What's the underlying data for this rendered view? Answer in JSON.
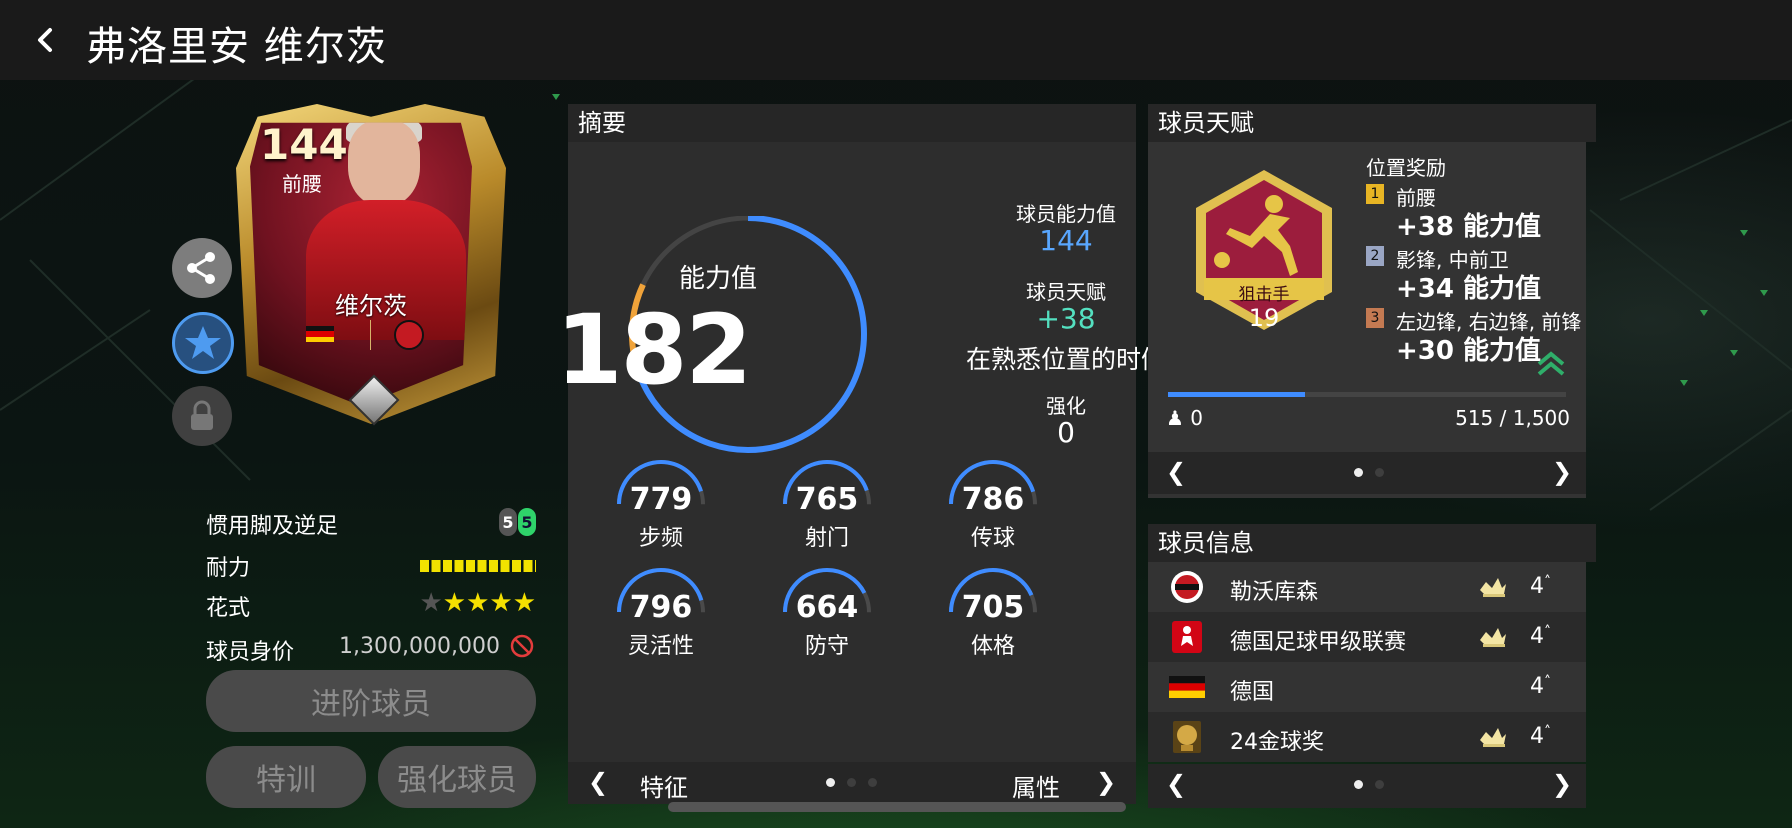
{
  "header": {
    "title": "弗洛里安 维尔茨"
  },
  "card": {
    "rating": "144",
    "position": "前腰",
    "name": "维尔茨",
    "nation_flag": "germany-flag",
    "club_badge": "leverkusen-badge"
  },
  "left_stats": {
    "foot_label": "惯用脚及逆足",
    "foot_values": [
      "5",
      "5"
    ],
    "stamina_label": "耐力",
    "skill_label": "花式",
    "skill_stars": 4,
    "skill_stars_max": 5,
    "price_label": "球员身价",
    "price_value": "1,300,000,000"
  },
  "buttons": {
    "upgrade": "进阶球员",
    "train": "特训",
    "enhance": "强化球员"
  },
  "summary": {
    "header": "摘要",
    "ring_label": "能力值",
    "ring_value": "182",
    "ring_fraction_blue": 0.72,
    "ring_fraction_orange": 0.1,
    "ability_label": "球员能力值",
    "ability_value": "144",
    "talent_label": "球员天赋",
    "talent_value": "+38",
    "talent_note": "在熟悉位置的时候",
    "enhance_label": "强化",
    "enhance_value": "0",
    "attributes": [
      {
        "name": "步频",
        "value": "779"
      },
      {
        "name": "射门",
        "value": "765"
      },
      {
        "name": "传球",
        "value": "786"
      },
      {
        "name": "灵活性",
        "value": "796"
      },
      {
        "name": "防守",
        "value": "664"
      },
      {
        "name": "体格",
        "value": "705"
      }
    ],
    "pager_left": "特征",
    "pager_right": "属性"
  },
  "talent": {
    "header": "球员天赋",
    "badge_name": "狙击手",
    "badge_level": "19",
    "bonus_title": "位置奖励",
    "bonuses": [
      {
        "rank": "1",
        "positions": "前腰",
        "amount": "+38 能力值",
        "color": "#e8b524"
      },
      {
        "rank": "2",
        "positions": "影锋, 中前卫",
        "amount": "+34 能力值",
        "color": "#9aa6c4"
      },
      {
        "rank": "3",
        "positions": "左边锋, 右边锋, 前锋",
        "amount": "+30 能力值",
        "color": "#c47a52"
      }
    ],
    "xp_left": "0",
    "xp_right": "515 / 1,500",
    "xp_fraction": 0.343
  },
  "info": {
    "header": "球员信息",
    "rows": [
      {
        "name": "勒沃库森",
        "level": "4",
        "icon": "leverkusen-icon",
        "crown": true
      },
      {
        "name": "德国足球甲级联赛",
        "level": "4",
        "icon": "bundesliga-icon",
        "crown": true
      },
      {
        "name": "德国",
        "level": "4",
        "icon": "germany-flag-icon",
        "crown": false
      },
      {
        "name": "24金球奖",
        "level": "4",
        "icon": "golden-ball-icon",
        "crown": true
      }
    ]
  },
  "colors": {
    "accent_blue": "#3f8cff",
    "accent_orange": "#f0a33a",
    "accent_green": "#54e0c0",
    "star_yellow": "#f5e000"
  }
}
